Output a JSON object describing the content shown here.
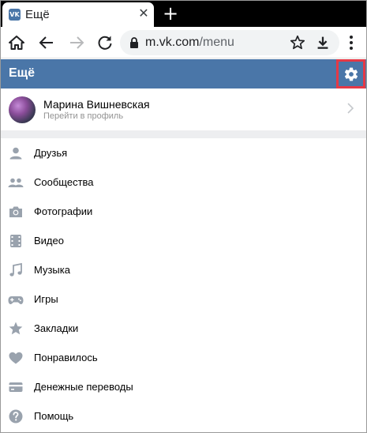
{
  "browser": {
    "tab_title": "Ещё",
    "tab_favicon_text": "VK",
    "tab_close": "✕",
    "new_tab": "+",
    "url_host": "m.vk.com",
    "url_path": "/menu"
  },
  "vk": {
    "header_title": "Ещё"
  },
  "profile": {
    "name": "Марина Вишневская",
    "subtitle": "Перейти в профиль"
  },
  "menu": {
    "items": [
      {
        "label": "Друзья",
        "icon": "person-icon"
      },
      {
        "label": "Сообщества",
        "icon": "groups-icon"
      },
      {
        "label": "Фотографии",
        "icon": "camera-icon"
      },
      {
        "label": "Видео",
        "icon": "video-icon"
      },
      {
        "label": "Музыка",
        "icon": "music-icon"
      },
      {
        "label": "Игры",
        "icon": "gamepad-icon"
      },
      {
        "label": "Закладки",
        "icon": "star-icon"
      },
      {
        "label": "Понравилось",
        "icon": "heart-icon"
      },
      {
        "label": "Денежные переводы",
        "icon": "card-icon"
      },
      {
        "label": "Помощь",
        "icon": "help-icon"
      }
    ]
  },
  "colors": {
    "vk_blue": "#4a76a8",
    "highlight_red": "#e53946",
    "icon_gray": "#99a2ad"
  }
}
